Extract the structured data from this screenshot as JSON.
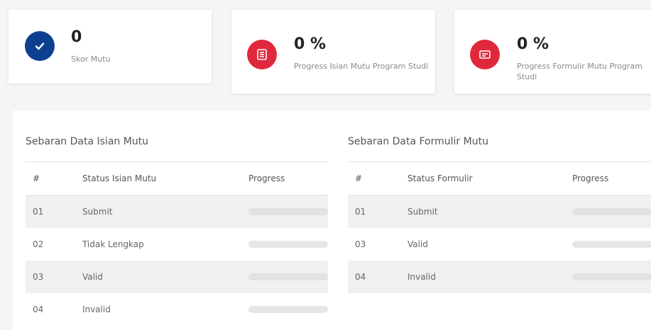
{
  "stats": [
    {
      "value": "0",
      "label": "Skor Mutu",
      "icon": "check-icon",
      "color": "#0c3f8f"
    },
    {
      "value": "0 %",
      "label": "Progress Isian Mutu Program Studi",
      "icon": "list-icon",
      "color": "#e0283c"
    },
    {
      "value": "0 %",
      "label": "Progress Formulir Mutu Program Studi",
      "icon": "form-icon",
      "color": "#e0283c"
    }
  ],
  "isian": {
    "title": "Sebaran Data Isian Mutu",
    "headers": [
      "#",
      "Status Isian Mutu",
      "Progress"
    ],
    "rows": [
      {
        "num": "01",
        "status": "Submit",
        "progress": 0
      },
      {
        "num": "02",
        "status": "Tidak Lengkap",
        "progress": 0
      },
      {
        "num": "03",
        "status": "Valid",
        "progress": 0
      },
      {
        "num": "04",
        "status": "Invalid",
        "progress": 0
      }
    ]
  },
  "formulir": {
    "title": "Sebaran Data Formulir Mutu",
    "headers": [
      "#",
      "Status Formulir",
      "Progress"
    ],
    "rows": [
      {
        "num": "01",
        "status": "Submit",
        "progress": 0
      },
      {
        "num": "03",
        "status": "Valid",
        "progress": 0
      },
      {
        "num": "04",
        "status": "Invalid",
        "progress": 0
      }
    ]
  }
}
